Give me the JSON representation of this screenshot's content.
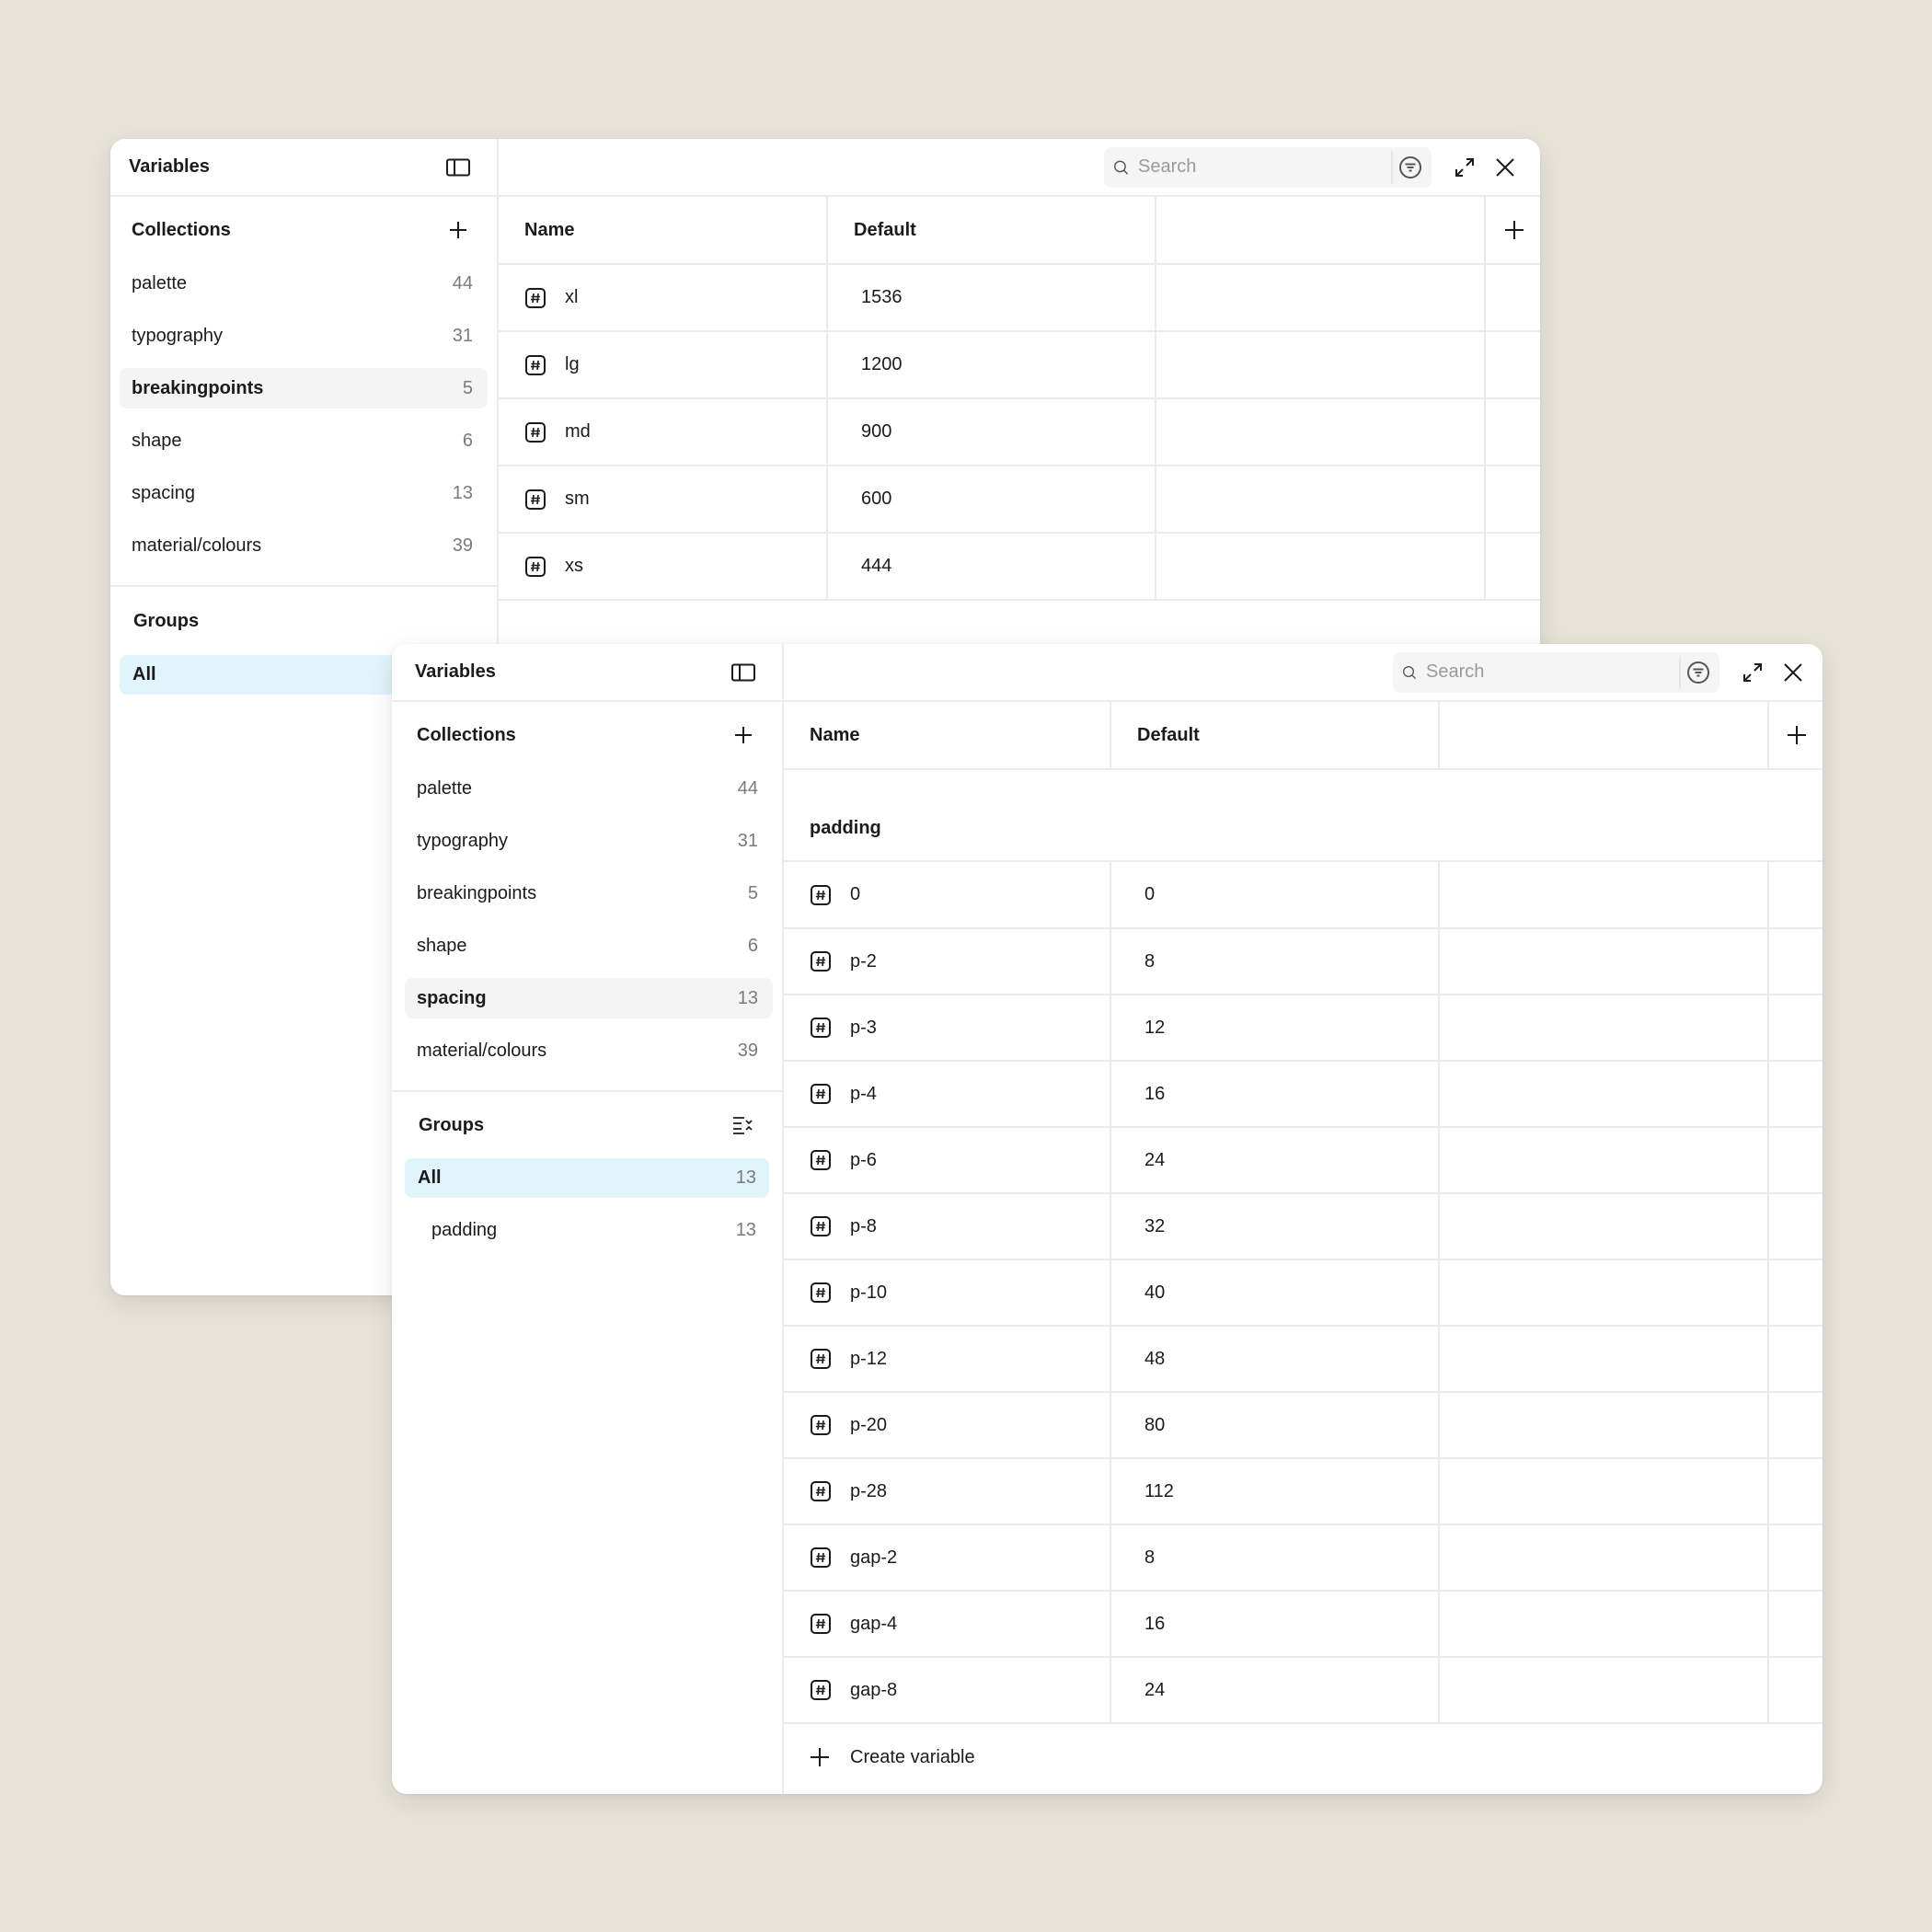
{
  "back": {
    "sidebar": {
      "title": "Variables",
      "collections_title": "Collections",
      "collections": [
        {
          "label": "palette",
          "count": "44"
        },
        {
          "label": "typography",
          "count": "31"
        },
        {
          "label": "breakingpoints",
          "count": "5"
        },
        {
          "label": "shape",
          "count": "6"
        },
        {
          "label": "spacing",
          "count": "13"
        },
        {
          "label": "material/colours",
          "count": "39"
        }
      ],
      "groups_title": "Groups",
      "groups": [
        {
          "label": "All"
        }
      ]
    },
    "search_placeholder": "Search",
    "columns": [
      "Name",
      "Default"
    ],
    "rows": [
      {
        "name": "xl",
        "value": "1536"
      },
      {
        "name": "lg",
        "value": "1200"
      },
      {
        "name": "md",
        "value": "900"
      },
      {
        "name": "sm",
        "value": "600"
      },
      {
        "name": "xs",
        "value": "444"
      }
    ]
  },
  "front": {
    "sidebar": {
      "title": "Variables",
      "collections_title": "Collections",
      "collections": [
        {
          "label": "palette",
          "count": "44"
        },
        {
          "label": "typography",
          "count": "31"
        },
        {
          "label": "breakingpoints",
          "count": "5"
        },
        {
          "label": "shape",
          "count": "6"
        },
        {
          "label": "spacing",
          "count": "13"
        },
        {
          "label": "material/colours",
          "count": "39"
        }
      ],
      "groups_title": "Groups",
      "groups": [
        {
          "label": "All",
          "count": "13"
        },
        {
          "label": "padding",
          "count": "13"
        }
      ]
    },
    "search_placeholder": "Search",
    "columns": [
      "Name",
      "Default"
    ],
    "group_label": "padding",
    "rows": [
      {
        "name": "0",
        "value": "0"
      },
      {
        "name": "p-2",
        "value": "8"
      },
      {
        "name": "p-3",
        "value": "12"
      },
      {
        "name": "p-4",
        "value": "16"
      },
      {
        "name": "p-6",
        "value": "24"
      },
      {
        "name": "p-8",
        "value": "32"
      },
      {
        "name": "p-10",
        "value": "40"
      },
      {
        "name": "p-12",
        "value": "48"
      },
      {
        "name": "p-20",
        "value": "80"
      },
      {
        "name": "p-28",
        "value": "112"
      },
      {
        "name": "gap-2",
        "value": "8"
      },
      {
        "name": "gap-4",
        "value": "16"
      },
      {
        "name": "gap-8",
        "value": "24"
      }
    ],
    "create_label": "Create variable"
  },
  "icons": {
    "sidebar_toggle": "sidebar-toggle-icon",
    "plus": "plus-icon",
    "search": "search-icon",
    "filter": "filter-icon",
    "expand": "expand-icon",
    "close": "close-icon",
    "number_variable": "number-variable-icon",
    "collapse_groups": "collapse-groups-icon"
  }
}
